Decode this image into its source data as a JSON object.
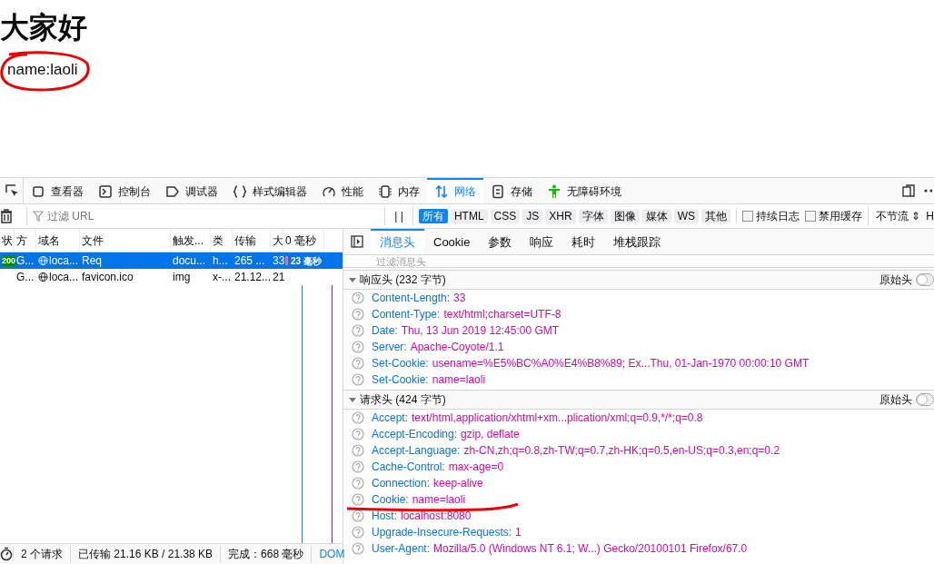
{
  "page": {
    "heading": "大家好",
    "text": "name:laoli"
  },
  "toolbar": {
    "tabs": [
      {
        "label": "查看器",
        "selected": false
      },
      {
        "label": "控制台",
        "selected": false
      },
      {
        "label": "调试器",
        "selected": false
      },
      {
        "label": "样式编辑器",
        "selected": false
      },
      {
        "label": "性能",
        "selected": false
      },
      {
        "label": "内存",
        "selected": false
      },
      {
        "label": "网络",
        "selected": true
      },
      {
        "label": "存储",
        "selected": false
      },
      {
        "label": "无障碍环境",
        "selected": false
      }
    ]
  },
  "filter_bar": {
    "placeholder": "过滤 URL",
    "pause": "| |",
    "types": [
      {
        "label": "所有",
        "selected": true
      },
      {
        "label": "HTML",
        "selected": false
      },
      {
        "label": "CSS",
        "selected": false
      },
      {
        "label": "JS",
        "selected": false
      },
      {
        "label": "XHR",
        "selected": false
      },
      {
        "label": "字体",
        "selected": false
      },
      {
        "label": "图像",
        "selected": false
      },
      {
        "label": "媒体",
        "selected": false
      },
      {
        "label": "WS",
        "selected": false
      },
      {
        "label": "其他",
        "selected": false
      }
    ],
    "checkboxes": [
      {
        "label": "持续日志",
        "checked": false
      },
      {
        "label": "禁用缓存",
        "checked": false
      }
    ],
    "throttle": "不节流 ⇕",
    "throttle_extra": "H"
  },
  "request_list": {
    "columns": [
      "状",
      "方",
      "域名",
      "文件",
      "触发...",
      "类",
      "传输",
      "大",
      "0 毫秒"
    ],
    "rows": [
      {
        "status": "200",
        "method": "G...",
        "domain": "loca...",
        "file": "Req",
        "cause": "docu...",
        "type": "h...",
        "transferred": "265 ...",
        "size": "33",
        "timing": "23 毫秒",
        "selected": true
      },
      {
        "method": "G...",
        "domain": "loca...",
        "file": "favicon.ico",
        "cause": "img",
        "type": "x-...",
        "transferred": "21.12...",
        "size": "21",
        "selected": false
      }
    ]
  },
  "status_bar": [
    "2 个请求",
    "已传输 21.16 KB / 21.38 KB",
    "完成：668 毫秒",
    "DOM"
  ],
  "details": {
    "tabs": [
      {
        "label": "消息头",
        "selected": true
      },
      {
        "label": "Cookie",
        "selected": false
      },
      {
        "label": "参数",
        "selected": false
      },
      {
        "label": "响应",
        "selected": false
      },
      {
        "label": "耗时",
        "selected": false
      },
      {
        "label": "堆栈跟踪",
        "selected": false
      }
    ],
    "filter_placeholder": "过滤消息头",
    "sections": [
      {
        "title": "响应头 (232 字节)",
        "raw_label": "原始头",
        "raw_on": false,
        "expanded": true,
        "headers": [
          {
            "name": "Content-Length:",
            "value": "33"
          },
          {
            "name": "Content-Type:",
            "value": "text/html;charset=UTF-8"
          },
          {
            "name": "Date:",
            "value": "Thu, 13 Jun 2019 12:45:00 GMT"
          },
          {
            "name": "Server:",
            "value": "Apache-Coyote/1.1"
          },
          {
            "name": "Set-Cookie:",
            "value": "usename=%E5%BC%A0%E4%B8%89; Ex...Thu, 01-Jan-1970 00:00:10 GMT"
          },
          {
            "name": "Set-Cookie:",
            "value": "name=laoli"
          }
        ]
      },
      {
        "title": "请求头 (424 字节)",
        "raw_label": "原始头",
        "raw_on": false,
        "expanded": true,
        "headers": [
          {
            "name": "Accept:",
            "value": "text/html,application/xhtml+xm...plication/xml;q=0.9,*/*;q=0.8"
          },
          {
            "name": "Accept-Encoding:",
            "value": "gzip, deflate"
          },
          {
            "name": "Accept-Language:",
            "value": "zh-CN,zh;q=0.8,zh-TW;q=0.7,zh-HK;q=0.5,en-US;q=0.3,en;q=0.2"
          },
          {
            "name": "Cache-Control:",
            "value": "max-age=0"
          },
          {
            "name": "Connection:",
            "value": "keep-alive"
          },
          {
            "name": "Cookie:",
            "value": "name=laoli"
          },
          {
            "name": "Host:",
            "value": "localhost:8080"
          },
          {
            "name": "Upgrade-Insecure-Requests:",
            "value": "1"
          },
          {
            "name": "User-Agent:",
            "value": "Mozilla/5.0 (Windows NT 6.1; W...) Gecko/20100101 Firefox/67.0"
          }
        ]
      }
    ]
  }
}
